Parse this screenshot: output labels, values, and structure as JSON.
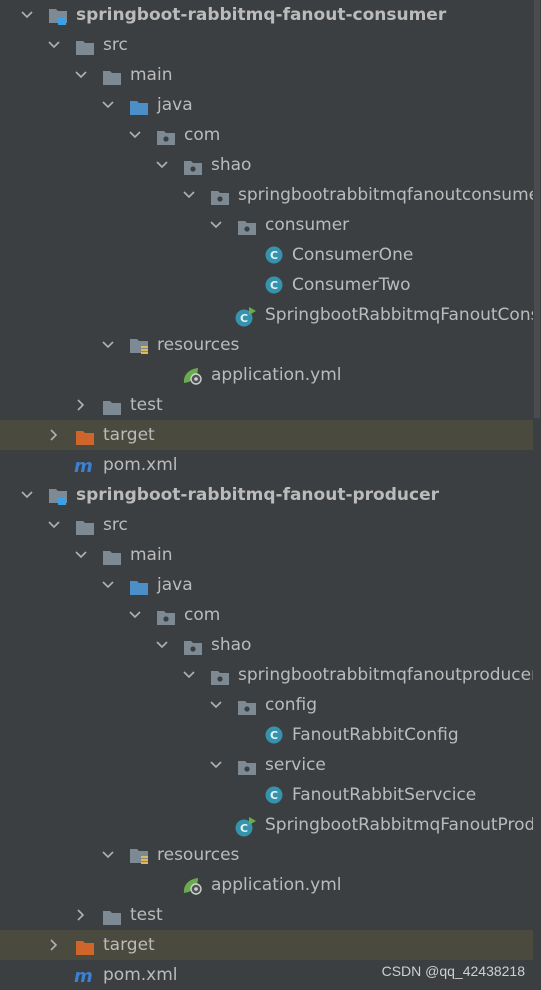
{
  "colors": {
    "background": "#3c3f41",
    "text": "#bbbbbb",
    "excluded_row": "#4b4a3e",
    "folder": "#7e8a93",
    "source_folder": "#4b8ec8",
    "excluded_folder": "#d0652b",
    "class_icon": "#3593ad",
    "maven": "#3d7fd1",
    "spring": "#6aab4f"
  },
  "projects": {
    "consumer": {
      "name": "springboot-rabbitmq-fanout-consumer",
      "src": "src",
      "main": "main",
      "java": "java",
      "com": "com",
      "shao": "shao",
      "pkg": "springbootrabbitmqfanoutconsumer",
      "subpkg": "consumer",
      "class1": "ConsumerOne",
      "class2": "ConsumerTwo",
      "app": "SpringbootRabbitmqFanoutConsumerApplication",
      "resources": "resources",
      "yml": "application.yml",
      "test": "test",
      "target": "target",
      "pom": "pom.xml"
    },
    "producer": {
      "name": "springboot-rabbitmq-fanout-producer",
      "src": "src",
      "main": "main",
      "java": "java",
      "com": "com",
      "shao": "shao",
      "pkg": "springbootrabbitmqfanoutproducer",
      "subpkg1": "config",
      "class1": "FanoutRabbitConfig",
      "subpkg2": "service",
      "class2": "FanoutRabbitServcice",
      "app": "SpringbootRabbitmqFanoutProducerApplication",
      "resources": "resources",
      "yml": "application.yml",
      "test": "test",
      "target": "target",
      "pom": "pom.xml"
    }
  },
  "watermark": "CSDN @qq_42438218"
}
